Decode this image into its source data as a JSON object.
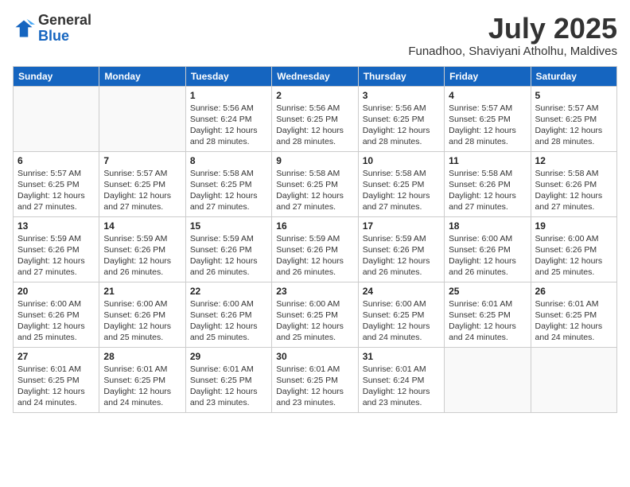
{
  "logo": {
    "general": "General",
    "blue": "Blue"
  },
  "header": {
    "month_year": "July 2025",
    "location": "Funadhoo, Shaviyani Atholhu, Maldives"
  },
  "days_of_week": [
    "Sunday",
    "Monday",
    "Tuesday",
    "Wednesday",
    "Thursday",
    "Friday",
    "Saturday"
  ],
  "weeks": [
    [
      {
        "day": "",
        "info": ""
      },
      {
        "day": "",
        "info": ""
      },
      {
        "day": "1",
        "info": "Sunrise: 5:56 AM\nSunset: 6:24 PM\nDaylight: 12 hours and 28 minutes."
      },
      {
        "day": "2",
        "info": "Sunrise: 5:56 AM\nSunset: 6:25 PM\nDaylight: 12 hours and 28 minutes."
      },
      {
        "day": "3",
        "info": "Sunrise: 5:56 AM\nSunset: 6:25 PM\nDaylight: 12 hours and 28 minutes."
      },
      {
        "day": "4",
        "info": "Sunrise: 5:57 AM\nSunset: 6:25 PM\nDaylight: 12 hours and 28 minutes."
      },
      {
        "day": "5",
        "info": "Sunrise: 5:57 AM\nSunset: 6:25 PM\nDaylight: 12 hours and 28 minutes."
      }
    ],
    [
      {
        "day": "6",
        "info": "Sunrise: 5:57 AM\nSunset: 6:25 PM\nDaylight: 12 hours and 27 minutes."
      },
      {
        "day": "7",
        "info": "Sunrise: 5:57 AM\nSunset: 6:25 PM\nDaylight: 12 hours and 27 minutes."
      },
      {
        "day": "8",
        "info": "Sunrise: 5:58 AM\nSunset: 6:25 PM\nDaylight: 12 hours and 27 minutes."
      },
      {
        "day": "9",
        "info": "Sunrise: 5:58 AM\nSunset: 6:25 PM\nDaylight: 12 hours and 27 minutes."
      },
      {
        "day": "10",
        "info": "Sunrise: 5:58 AM\nSunset: 6:25 PM\nDaylight: 12 hours and 27 minutes."
      },
      {
        "day": "11",
        "info": "Sunrise: 5:58 AM\nSunset: 6:26 PM\nDaylight: 12 hours and 27 minutes."
      },
      {
        "day": "12",
        "info": "Sunrise: 5:58 AM\nSunset: 6:26 PM\nDaylight: 12 hours and 27 minutes."
      }
    ],
    [
      {
        "day": "13",
        "info": "Sunrise: 5:59 AM\nSunset: 6:26 PM\nDaylight: 12 hours and 27 minutes."
      },
      {
        "day": "14",
        "info": "Sunrise: 5:59 AM\nSunset: 6:26 PM\nDaylight: 12 hours and 26 minutes."
      },
      {
        "day": "15",
        "info": "Sunrise: 5:59 AM\nSunset: 6:26 PM\nDaylight: 12 hours and 26 minutes."
      },
      {
        "day": "16",
        "info": "Sunrise: 5:59 AM\nSunset: 6:26 PM\nDaylight: 12 hours and 26 minutes."
      },
      {
        "day": "17",
        "info": "Sunrise: 5:59 AM\nSunset: 6:26 PM\nDaylight: 12 hours and 26 minutes."
      },
      {
        "day": "18",
        "info": "Sunrise: 6:00 AM\nSunset: 6:26 PM\nDaylight: 12 hours and 26 minutes."
      },
      {
        "day": "19",
        "info": "Sunrise: 6:00 AM\nSunset: 6:26 PM\nDaylight: 12 hours and 25 minutes."
      }
    ],
    [
      {
        "day": "20",
        "info": "Sunrise: 6:00 AM\nSunset: 6:26 PM\nDaylight: 12 hours and 25 minutes."
      },
      {
        "day": "21",
        "info": "Sunrise: 6:00 AM\nSunset: 6:26 PM\nDaylight: 12 hours and 25 minutes."
      },
      {
        "day": "22",
        "info": "Sunrise: 6:00 AM\nSunset: 6:26 PM\nDaylight: 12 hours and 25 minutes."
      },
      {
        "day": "23",
        "info": "Sunrise: 6:00 AM\nSunset: 6:25 PM\nDaylight: 12 hours and 25 minutes."
      },
      {
        "day": "24",
        "info": "Sunrise: 6:00 AM\nSunset: 6:25 PM\nDaylight: 12 hours and 24 minutes."
      },
      {
        "day": "25",
        "info": "Sunrise: 6:01 AM\nSunset: 6:25 PM\nDaylight: 12 hours and 24 minutes."
      },
      {
        "day": "26",
        "info": "Sunrise: 6:01 AM\nSunset: 6:25 PM\nDaylight: 12 hours and 24 minutes."
      }
    ],
    [
      {
        "day": "27",
        "info": "Sunrise: 6:01 AM\nSunset: 6:25 PM\nDaylight: 12 hours and 24 minutes."
      },
      {
        "day": "28",
        "info": "Sunrise: 6:01 AM\nSunset: 6:25 PM\nDaylight: 12 hours and 24 minutes."
      },
      {
        "day": "29",
        "info": "Sunrise: 6:01 AM\nSunset: 6:25 PM\nDaylight: 12 hours and 23 minutes."
      },
      {
        "day": "30",
        "info": "Sunrise: 6:01 AM\nSunset: 6:25 PM\nDaylight: 12 hours and 23 minutes."
      },
      {
        "day": "31",
        "info": "Sunrise: 6:01 AM\nSunset: 6:24 PM\nDaylight: 12 hours and 23 minutes."
      },
      {
        "day": "",
        "info": ""
      },
      {
        "day": "",
        "info": ""
      }
    ]
  ]
}
